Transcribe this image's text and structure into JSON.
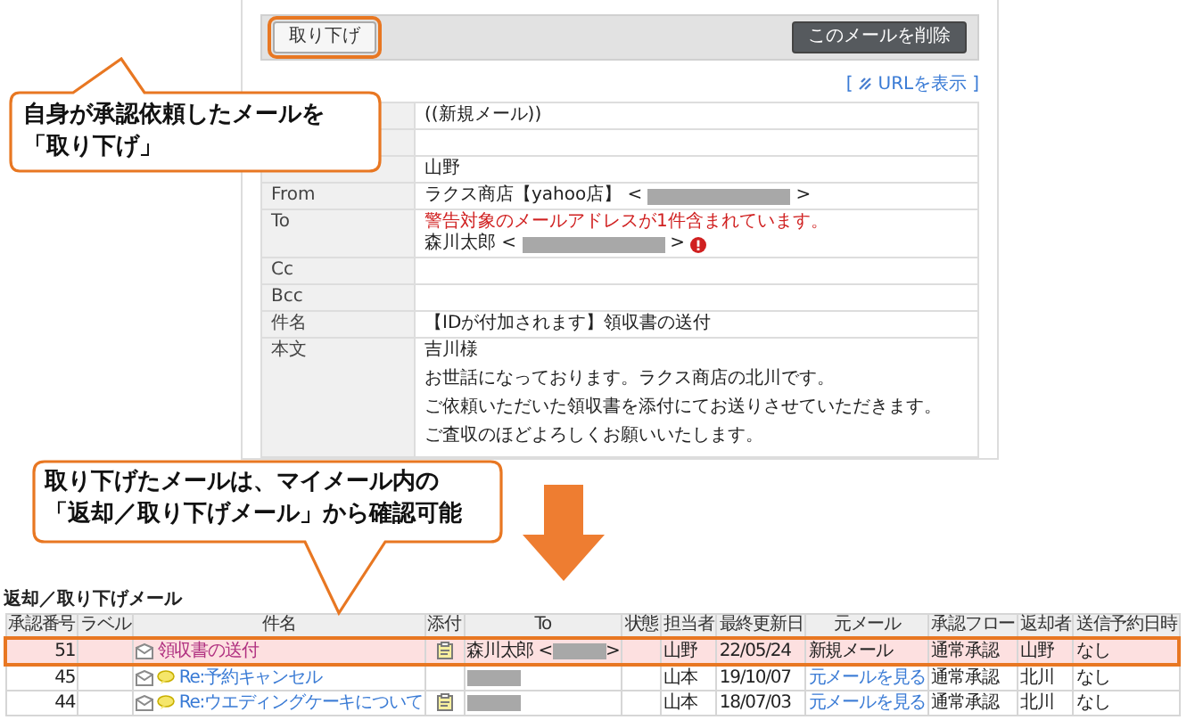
{
  "detail_panel": {
    "toolbar": {
      "withdraw_button": {
        "label": "取り下げ",
        "highlighted": true
      },
      "delete_button": "このメールを削除"
    },
    "url_link": {
      "before": "[",
      "label": "URLを表示",
      "after": "]"
    },
    "fields": [
      {
        "kind": "text",
        "value": "((新規メール))"
      },
      {
        "kind": "empty"
      },
      {
        "kind": "text",
        "value": "山野"
      },
      {
        "kind": "address",
        "label": "From",
        "name": "ラクス商店【yahoo店】",
        "open": "<",
        "close": ">"
      },
      {
        "kind": "warning_address",
        "label": "To",
        "warning": "警告対象のメールアドレスが1件含まれています。",
        "name": "森川太郎",
        "open": "<",
        "close": ">"
      },
      {
        "kind": "empty",
        "label": "Cc"
      },
      {
        "kind": "empty",
        "label": "Bcc"
      },
      {
        "kind": "text",
        "label": "件名",
        "value": "【IDが付加されます】領収書の送付"
      },
      {
        "kind": "body",
        "label": "本文",
        "paragraphs": [
          "吉川様",
          "お世話になっております。ラクス商店の北川です。",
          "ご依頼いただいた領収書を添付にてお送りさせていただきます。",
          "ご査収のほどよろしくお願いいたします。"
        ]
      }
    ]
  },
  "callouts": [
    {
      "lines": [
        "自身が承認依頼したメールを",
        "「取り下げ」"
      ]
    },
    {
      "lines": [
        "取り下げたメールは、マイメール内の",
        "「返却／取り下げメール」から確認可能"
      ]
    }
  ],
  "returned_list": {
    "title": "返却／取り下げメール",
    "columns": [
      "承認番号",
      "ラベル",
      "件名",
      "添付",
      "To",
      "状態",
      "担当者",
      "最終更新日",
      "元メール",
      "承認フロー",
      "返却者",
      "送信予約日時"
    ],
    "rows": [
      {
        "selected": true,
        "number": "51",
        "subject": "領収書の送付",
        "subject_link": false,
        "comment": false,
        "attachment": true,
        "to_name": "森川太郎",
        "to_open": "<",
        "to_close": ">",
        "owner": "山野",
        "updated": "22/05/24",
        "original": {
          "text": "新規メール",
          "link": false
        },
        "flow": "通常承認",
        "returner": "山野",
        "scheduled": "なし"
      },
      {
        "selected": false,
        "number": "45",
        "subject": "Re:予約キャンセル",
        "subject_link": true,
        "comment": true,
        "attachment": false,
        "owner": "山本",
        "updated": "19/10/07",
        "original": {
          "text": "元メールを見る",
          "link": true
        },
        "flow": "通常承認",
        "returner": "北川",
        "scheduled": "なし"
      },
      {
        "selected": false,
        "number": "44",
        "subject": "Re:ウエディングケーキについて",
        "subject_link": true,
        "comment": true,
        "attachment": true,
        "owner": "山本",
        "updated": "18/07/03",
        "original": {
          "text": "元メールを見る",
          "link": true
        },
        "flow": "通常承認",
        "returner": "北川",
        "scheduled": "なし"
      }
    ]
  }
}
